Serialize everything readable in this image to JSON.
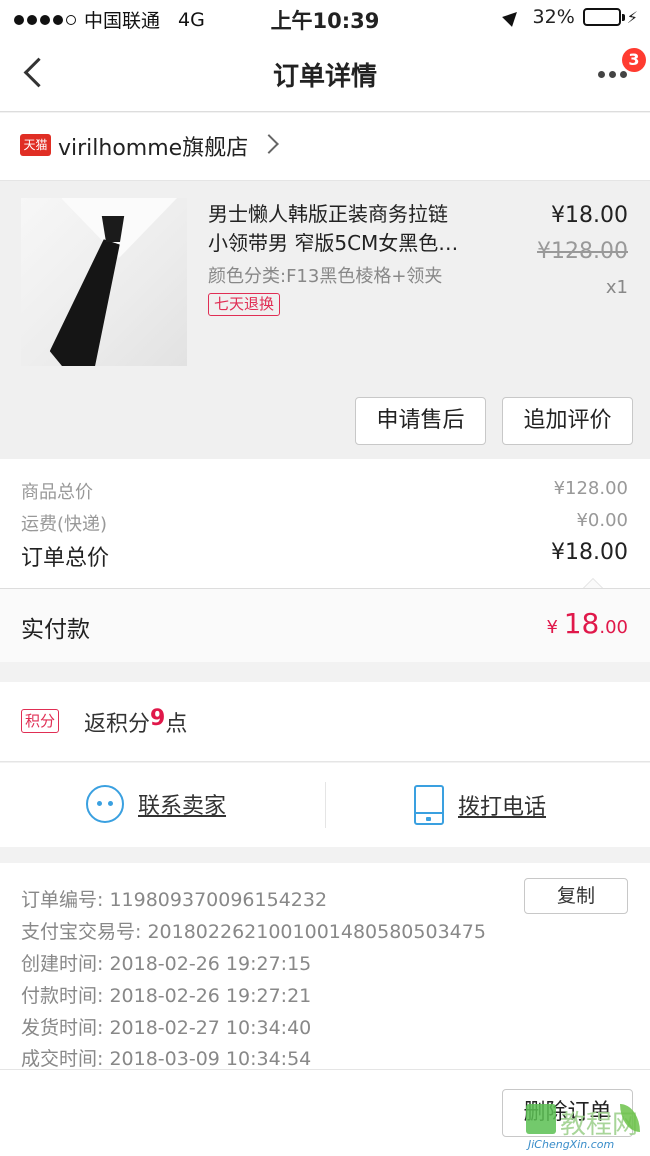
{
  "status_bar": {
    "signal_dots": 5,
    "signal_filled": 4,
    "carrier": "中国联通",
    "network": "4G",
    "time": "上午10:39",
    "battery_percent_label": "32%",
    "battery_level": 0.32
  },
  "nav": {
    "title": "订单详情",
    "badge_count": "3"
  },
  "shop": {
    "logo_text": "天猫",
    "name": "virilhomme旗舰店"
  },
  "product": {
    "title_line1": "男士懒人韩版正装商务拉链",
    "title_line2": "小领带男 窄版5CM女黑色…",
    "spec": "颜色分类:F13黑色棱格+领夹",
    "tag": "七天退换",
    "price": "¥18.00",
    "original_price": "¥128.00",
    "quantity": "x1",
    "buttons": {
      "after_sale": "申请售后",
      "add_review": "追加评价"
    }
  },
  "summary": {
    "goods_total_label": "商品总价",
    "goods_total_value": "¥128.00",
    "shipping_label": "运费(快递)",
    "shipping_value": "¥0.00",
    "order_total_label": "订单总价",
    "order_total_value": "¥18.00",
    "paid_label": "实付款",
    "paid_currency": "¥",
    "paid_int": "18",
    "paid_dec": ".00"
  },
  "points": {
    "tag": "积分",
    "prefix": "返积分",
    "number": "9",
    "suffix": "点"
  },
  "contact": {
    "seller_label": "联系卖家",
    "phone_label": "拨打电话"
  },
  "order_info": {
    "order_no_label": "订单编号:",
    "order_no": "119809370096154232",
    "copy_button": "复制",
    "alipay_label": "支付宝交易号:",
    "alipay_no": "2018022621001001480580503475",
    "created_label": "创建时间:",
    "created": "2018-02-26 19:27:15",
    "paid_label": "付款时间:",
    "paid": "2018-02-26 19:27:21",
    "shipped_label": "发货时间:",
    "shipped": "2018-02-27 10:34:40",
    "completed_label": "成交时间:",
    "completed": "2018-03-09 10:34:54"
  },
  "footer": {
    "delete_button": "删除订单"
  },
  "watermark": {
    "text": "教程网",
    "url": "JiChengXin.com"
  },
  "colors": {
    "accent_red": "#e0184a",
    "tmall_red": "#e02e24",
    "icon_blue": "#3aa0e0",
    "battery_green": "#3cc051"
  }
}
